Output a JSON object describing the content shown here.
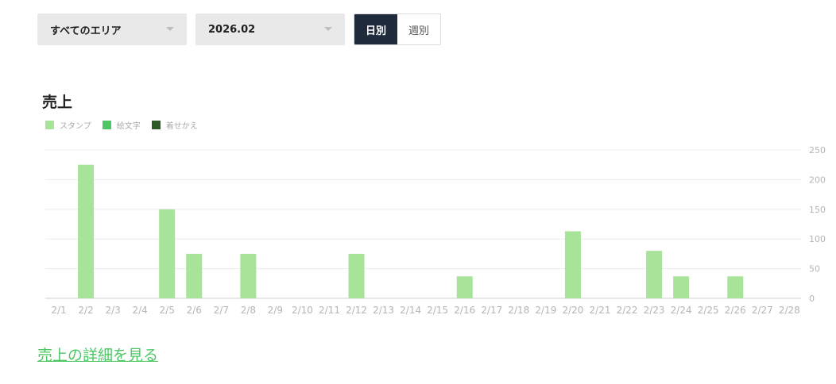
{
  "filters": {
    "area": {
      "label": "すべてのエリア"
    },
    "month": {
      "label": "2026.02"
    },
    "period_toggle": {
      "options": [
        {
          "label": "日別",
          "active": true
        },
        {
          "label": "週別",
          "active": false
        }
      ]
    }
  },
  "sales": {
    "title": "売上",
    "detail_link": "売上の詳細を見る"
  },
  "colors": {
    "stamp": "#a8e39a",
    "emoji": "#4cc764",
    "theme": "#2f5a27",
    "accent": "#4cc764",
    "toggle_active": "#1f2a3d"
  },
  "chart_data": {
    "type": "bar",
    "title": "売上",
    "legend_position": "top-left",
    "grid": true,
    "categories": [
      "2/1",
      "2/2",
      "2/3",
      "2/4",
      "2/5",
      "2/6",
      "2/7",
      "2/8",
      "2/9",
      "2/10",
      "2/11",
      "2/12",
      "2/13",
      "2/14",
      "2/15",
      "2/16",
      "2/17",
      "2/18",
      "2/19",
      "2/20",
      "2/21",
      "2/22",
      "2/23",
      "2/24",
      "2/25",
      "2/26",
      "2/27",
      "2/28"
    ],
    "series": [
      {
        "name": "スタンプ",
        "color": "#a8e39a",
        "values": [
          0,
          225,
          0,
          0,
          150,
          75,
          0,
          75,
          0,
          0,
          0,
          75,
          0,
          0,
          0,
          37,
          0,
          0,
          0,
          113,
          0,
          0,
          80,
          37,
          0,
          37,
          0,
          0
        ]
      },
      {
        "name": "絵文字",
        "color": "#4cc764",
        "values": [
          0,
          0,
          0,
          0,
          0,
          0,
          0,
          0,
          0,
          0,
          0,
          0,
          0,
          0,
          0,
          0,
          0,
          0,
          0,
          0,
          0,
          0,
          0,
          0,
          0,
          0,
          0,
          0
        ]
      },
      {
        "name": "着せかえ",
        "color": "#2f5a27",
        "values": [
          0,
          0,
          0,
          0,
          0,
          0,
          0,
          0,
          0,
          0,
          0,
          0,
          0,
          0,
          0,
          0,
          0,
          0,
          0,
          0,
          0,
          0,
          0,
          0,
          0,
          0,
          0,
          0
        ]
      }
    ],
    "y_ticks": [
      "0",
      "50",
      "100",
      "150",
      "200",
      "250"
    ],
    "ylim": [
      0,
      250
    ]
  }
}
